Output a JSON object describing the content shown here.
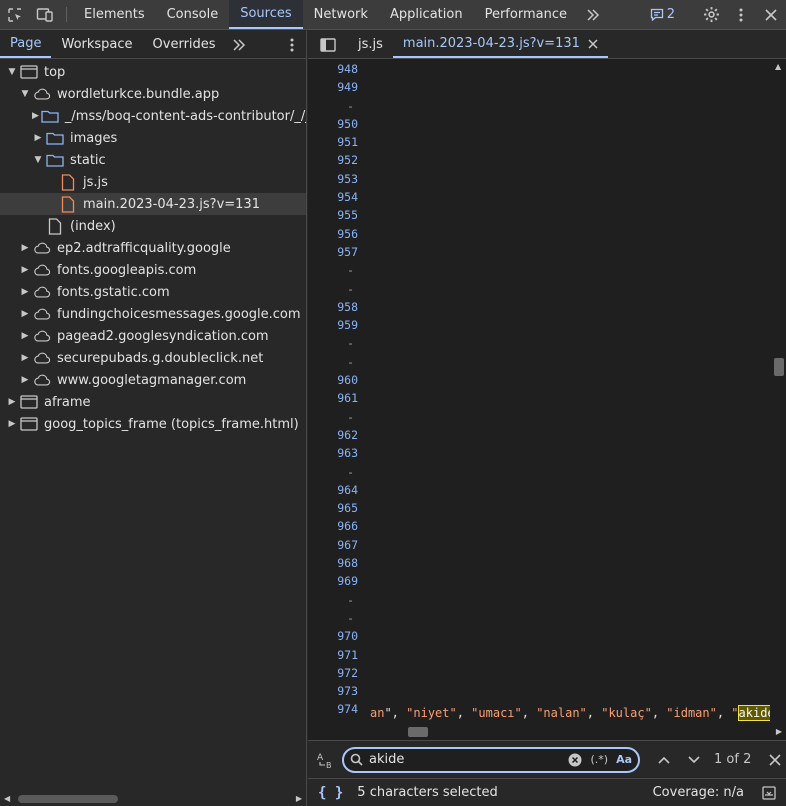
{
  "main_tabs": [
    "Elements",
    "Console",
    "Sources",
    "Network",
    "Application",
    "Performance"
  ],
  "issues_count": "2",
  "nav_tabs": [
    "Page",
    "Workspace",
    "Overrides"
  ],
  "tree": [
    {
      "label": "top",
      "level": 0,
      "type": "frame",
      "arrow": "down"
    },
    {
      "label": "wordleturkce.bundle.app",
      "level": 1,
      "type": "cloud",
      "arrow": "down"
    },
    {
      "label": "_/mss/boq-content-ads-contributor/_/js/",
      "level": 2,
      "type": "folder",
      "arrow": "right"
    },
    {
      "label": "images",
      "level": 2,
      "type": "folder",
      "arrow": "right"
    },
    {
      "label": "static",
      "level": 2,
      "type": "folder",
      "arrow": "down"
    },
    {
      "label": "js.js",
      "level": 3,
      "type": "file-js",
      "arrow": ""
    },
    {
      "label": "main.2023-04-23.js?v=131",
      "level": 3,
      "type": "file-js",
      "arrow": "",
      "selected": true
    },
    {
      "label": "(index)",
      "level": 2,
      "type": "file",
      "arrow": ""
    },
    {
      "label": "ep2.adtrafficquality.google",
      "level": 1,
      "type": "cloud",
      "arrow": "right"
    },
    {
      "label": "fonts.googleapis.com",
      "level": 1,
      "type": "cloud",
      "arrow": "right"
    },
    {
      "label": "fonts.gstatic.com",
      "level": 1,
      "type": "cloud",
      "arrow": "right"
    },
    {
      "label": "fundingchoicesmessages.google.com",
      "level": 1,
      "type": "cloud",
      "arrow": "right"
    },
    {
      "label": "pagead2.googlesyndication.com",
      "level": 1,
      "type": "cloud",
      "arrow": "right"
    },
    {
      "label": "securepubads.g.doubleclick.net",
      "level": 1,
      "type": "cloud",
      "arrow": "right"
    },
    {
      "label": "www.googletagmanager.com",
      "level": 1,
      "type": "cloud",
      "arrow": "right"
    },
    {
      "label": "aframe",
      "level": 0,
      "type": "frame",
      "arrow": "right"
    },
    {
      "label": "goog_topics_frame (topics_frame.html)",
      "level": 0,
      "type": "frame",
      "arrow": "right"
    }
  ],
  "editor_tabs": [
    "js.js",
    "main.2023-04-23.js?v=131"
  ],
  "line_numbers": [
    "948",
    "949",
    "-",
    "950",
    "951",
    "952",
    "953",
    "954",
    "955",
    "956",
    "957",
    "-",
    "-",
    "958",
    "959",
    "-",
    "-",
    "960",
    "961",
    "-",
    "962",
    "963",
    "-",
    "964",
    "965",
    "966",
    "967",
    "968",
    "969",
    "-",
    "-",
    "970",
    "971",
    "972",
    "973",
    "974"
  ],
  "code_tokens": [
    {
      "t": "an",
      "c": "s-str"
    },
    {
      "t": "\", ",
      "c": "s-punc"
    },
    {
      "t": "\"niyet\"",
      "c": "s-str"
    },
    {
      "t": ", ",
      "c": "s-punc"
    },
    {
      "t": "\"umacı\"",
      "c": "s-str"
    },
    {
      "t": ", ",
      "c": "s-punc"
    },
    {
      "t": "\"nalan\"",
      "c": "s-str"
    },
    {
      "t": ", ",
      "c": "s-punc"
    },
    {
      "t": "\"kulaç\"",
      "c": "s-str"
    },
    {
      "t": ", ",
      "c": "s-punc"
    },
    {
      "t": "\"idman\"",
      "c": "s-str"
    },
    {
      "t": ", ",
      "c": "s-punc"
    },
    {
      "t": "\"",
      "c": "s-str"
    },
    {
      "t": "akide",
      "c": "hl"
    },
    {
      "t": "\"",
      "c": "s-str"
    }
  ],
  "search": {
    "value": "akide",
    "regex_label": "(.*)",
    "case_label": "Aa",
    "match_count": "1 of 2"
  },
  "status": {
    "selection": "5 characters selected",
    "coverage": "Coverage: n/a"
  },
  "colors": {
    "accent": "#a8c7fa",
    "string": "#fc9e72",
    "line_number": "#8ab4f8",
    "file_icon": "#f28b54"
  }
}
